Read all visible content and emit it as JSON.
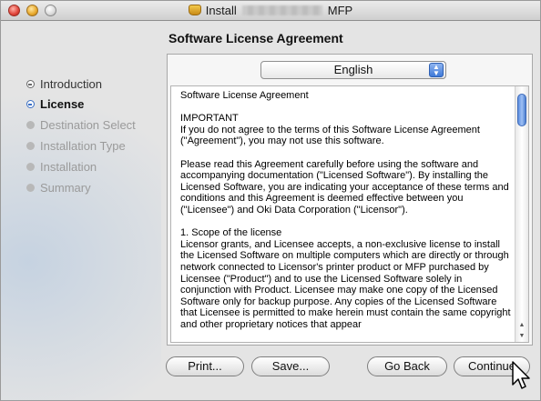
{
  "window": {
    "title_prefix": "Install",
    "title_suffix": "MFP",
    "title_icon": "installer-package-icon"
  },
  "heading": "Software License Agreement",
  "sidebar": {
    "steps": [
      {
        "label": "Introduction",
        "state": "done"
      },
      {
        "label": "License",
        "state": "current"
      },
      {
        "label": "Destination Select",
        "state": "future"
      },
      {
        "label": "Installation Type",
        "state": "future"
      },
      {
        "label": "Installation",
        "state": "future"
      },
      {
        "label": "Summary",
        "state": "future"
      }
    ]
  },
  "language_select": {
    "value": "English"
  },
  "license_text": {
    "p1": "Software License Agreement",
    "p2": "IMPORTANT\nIf you do not agree to the terms of this Software License Agreement (\"Agreement\"), you may not use this software.",
    "p3": "Please read this Agreement carefully before using the software and accompanying documentation (\"Licensed Software\"). By installing the Licensed Software, you are indicating your acceptance of these terms and conditions and this Agreement is deemed effective between you (\"Licensee\") and Oki Data Corporation (\"Licensor\").",
    "p4": "1. Scope of the license\nLicensor grants, and Licensee accepts, a non-exclusive license to install the Licensed Software on multiple computers which are directly or through network connected to Licensor's printer product or MFP purchased by Licensee (\"Product\") and to use the Licensed Software solely in conjunction with Product. Licensee may make one copy of the Licensed Software only for backup purpose. Any copies of the Licensed Software that Licensee is permitted to make herein must contain the same copyright and other proprietary notices that appear"
  },
  "buttons": {
    "print": "Print...",
    "save": "Save...",
    "go_back": "Go Back",
    "continue": "Continue"
  },
  "colors": {
    "accent_blue": "#3b6fc4",
    "scroll_thumb": "#5d8fe0"
  }
}
